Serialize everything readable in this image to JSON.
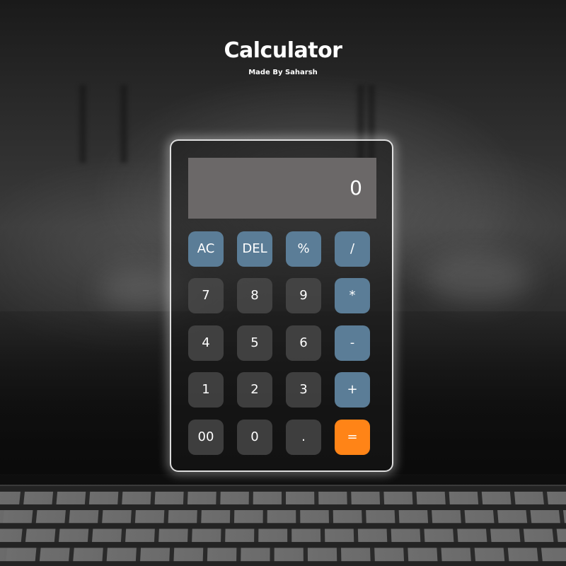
{
  "header": {
    "title": "Calculator",
    "subtitle": "Made By Saharsh"
  },
  "calculator": {
    "display_value": "0",
    "keys": {
      "ac": "AC",
      "del": "DEL",
      "percent": "%",
      "divide": "/",
      "seven": "7",
      "eight": "8",
      "nine": "9",
      "multiply": "*",
      "four": "4",
      "five": "5",
      "six": "6",
      "subtract": "-",
      "one": "1",
      "two": "2",
      "three": "3",
      "add": "+",
      "double_zero": "00",
      "zero": "0",
      "decimal": ".",
      "equals": "="
    }
  },
  "colors": {
    "function_key": "#5b7d97",
    "number_key": "#4e4e4e",
    "equals_key": "#ff8417",
    "display_background": "#6b6868"
  }
}
